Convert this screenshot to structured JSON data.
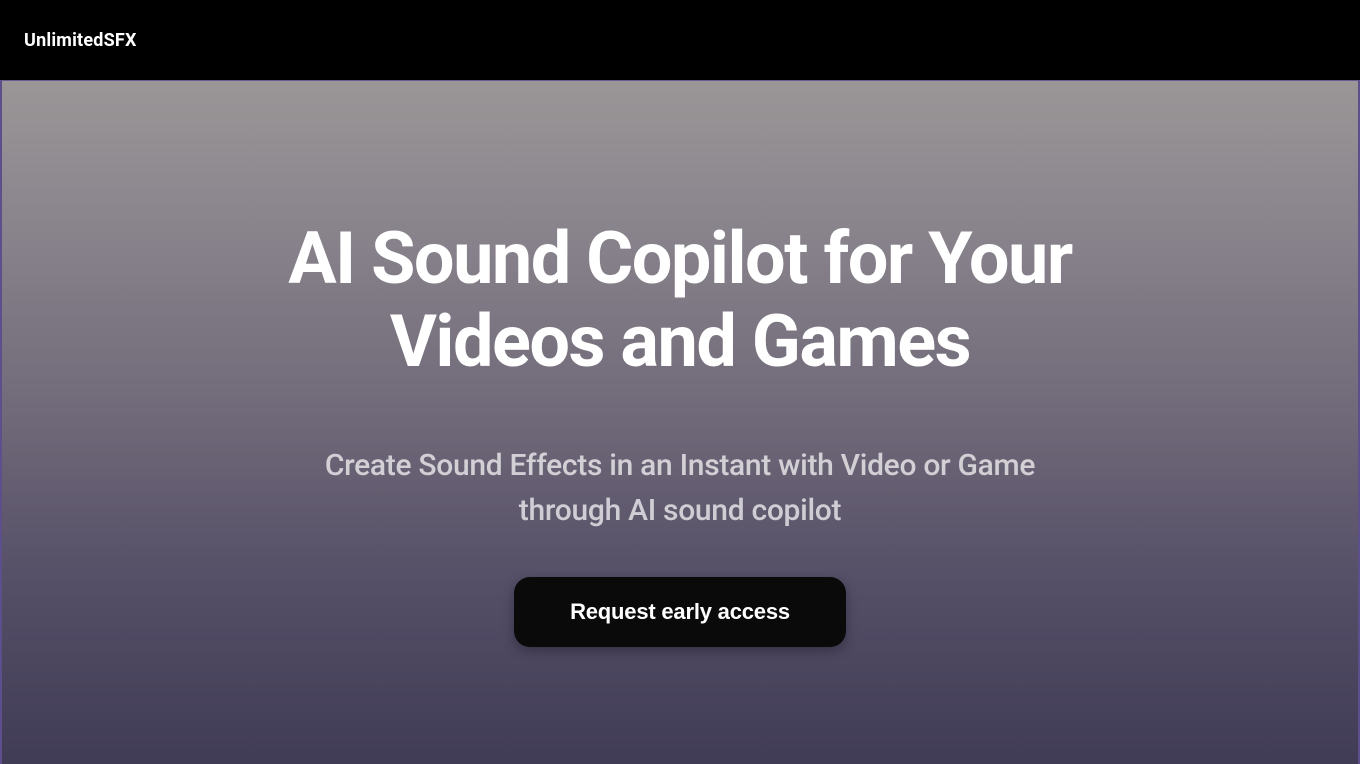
{
  "header": {
    "logo": "UnlimitedSFX"
  },
  "hero": {
    "title": "AI Sound Copilot for Your Videos and Games",
    "subtitle": "Create Sound Effects in an Instant with Video or Game through AI sound copilot",
    "cta_label": "Request early access"
  }
}
